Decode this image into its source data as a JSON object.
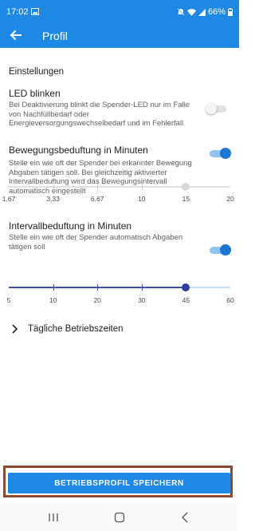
{
  "status_bar": {
    "time": "17:02",
    "battery": "66%",
    "icons": [
      "image-icon",
      "silent-icon",
      "wifi-icon",
      "signal-icon",
      "battery-icon"
    ]
  },
  "app_bar": {
    "title": "Profil",
    "back_icon": "arrow-left-icon",
    "color": "#1e88e5"
  },
  "settings": {
    "heading": "Einstellungen",
    "led": {
      "title": "LED blinken",
      "description": "Bei Deaktivierung blinkt die Spender-LED nur im Falle von Nachfüllbedarf oder Energieversorgungswechselbedarf und im Fehlerfall",
      "enabled": false
    },
    "motion": {
      "title": "Bewegungsbeduftung in Minuten",
      "description": "Stelle ein wie oft der Spender bei erkannter Bewegung Abgaben tätigen soll. Bei gleichzeitig aktivierter Intervallbeduftung wird das Bewegungsintervall automatisch eingestellt",
      "enabled": true,
      "slider_enabled": false,
      "value": 15,
      "tick_labels": [
        "1,67",
        "3,33",
        "6,67",
        "10",
        "15",
        "20"
      ]
    },
    "interval": {
      "title": "Intervallbeduftung in Minuten",
      "description": "Stelle ein wie oft der Spender automatisch Abgaben tätigen soll",
      "enabled": true,
      "value": 45,
      "tick_labels": [
        "5",
        "10",
        "20",
        "30",
        "45",
        "60"
      ]
    },
    "business_hours": {
      "label": "Tägliche Betriebszeiten",
      "icon": "chevron-right-icon"
    }
  },
  "save_button": {
    "label": "BETRIEBSPROFIL SPEICHERN"
  },
  "nav_bar": {
    "buttons": [
      "recent-apps-icon",
      "home-icon",
      "back-icon"
    ]
  },
  "colors": {
    "primary": "#1e88e5",
    "slider_active": "#3f51b5",
    "toggle_on": "#1976d2",
    "highlight_frame": "#8b4a2f"
  }
}
